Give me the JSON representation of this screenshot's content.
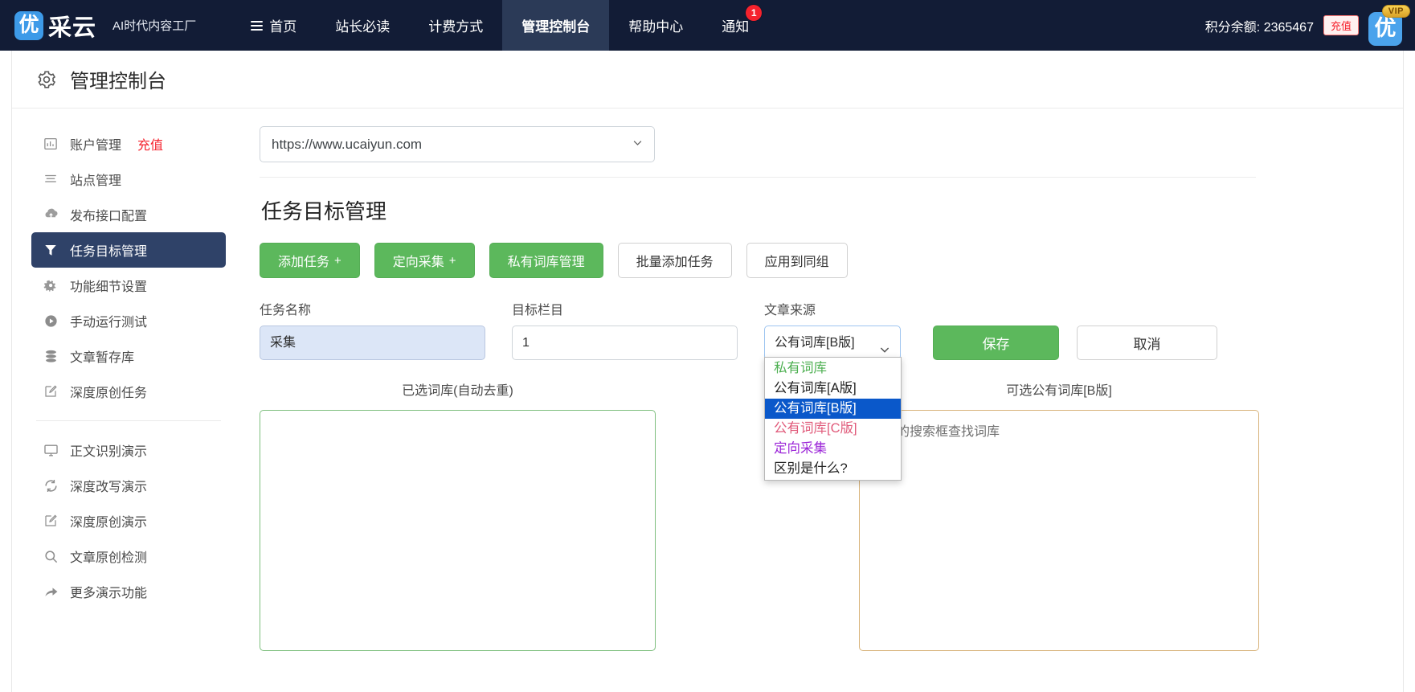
{
  "topnav": {
    "logo_badge": "优",
    "logo_text": "采云",
    "slogan": "AI时代内容工厂",
    "items": [
      {
        "label": "首页",
        "icon": "hamburger-icon",
        "active": false,
        "badge": ""
      },
      {
        "label": "站长必读",
        "icon": "",
        "active": false,
        "badge": ""
      },
      {
        "label": "计费方式",
        "icon": "",
        "active": false,
        "badge": ""
      },
      {
        "label": "管理控制台",
        "icon": "",
        "active": true,
        "badge": ""
      },
      {
        "label": "帮助中心",
        "icon": "",
        "active": false,
        "badge": ""
      },
      {
        "label": "通知",
        "icon": "",
        "active": false,
        "badge": "1"
      }
    ],
    "points_label": "积分余额: 2365467",
    "recharge_label": "充值",
    "avatar_letter": "优",
    "vip_label": "VIP",
    "colors": {
      "bar_bg": "#121c36",
      "active_bg": "#2b3a57",
      "badge_red": "#f5222d",
      "logo_blue": "#3d9ae8"
    }
  },
  "page": {
    "title": "管理控制台",
    "title_icon": "gear-icon"
  },
  "sidebar": {
    "items": [
      {
        "label": "账户管理",
        "sub": "充值",
        "icon": "chart-bar-icon",
        "active": false
      },
      {
        "label": "站点管理",
        "sub": "",
        "icon": "list-lines-icon",
        "active": false
      },
      {
        "label": "发布接口配置",
        "sub": "",
        "icon": "cloud-upload-icon",
        "active": false
      },
      {
        "label": "任务目标管理",
        "sub": "",
        "icon": "filter-icon",
        "active": true
      },
      {
        "label": "功能细节设置",
        "sub": "",
        "icon": "gears-icon",
        "active": false
      },
      {
        "label": "手动运行测试",
        "sub": "",
        "icon": "play-circle-icon",
        "active": false
      },
      {
        "label": "文章暂存库",
        "sub": "",
        "icon": "database-icon",
        "active": false
      },
      {
        "label": "深度原创任务",
        "sub": "",
        "icon": "edit-square-icon",
        "active": false
      }
    ],
    "items2": [
      {
        "label": "正文识别演示",
        "icon": "monitor-icon"
      },
      {
        "label": "深度改写演示",
        "icon": "refresh-icon"
      },
      {
        "label": "深度原创演示",
        "icon": "edit-square-icon"
      },
      {
        "label": "文章原创检测",
        "icon": "search-icon"
      },
      {
        "label": "更多演示功能",
        "icon": "arrow-right-curve-icon"
      }
    ]
  },
  "main": {
    "site_select": {
      "value": "https://www.ucaiyun.com",
      "icon": "chevron-down-icon"
    },
    "section_title": "任务目标管理",
    "buttons": [
      {
        "label": "添加任务",
        "plus": "+",
        "style": "green"
      },
      {
        "label": "定向采集",
        "plus": "+",
        "style": "green"
      },
      {
        "label": "私有词库管理",
        "plus": "",
        "style": "green"
      },
      {
        "label": "批量添加任务",
        "plus": "",
        "style": "white"
      },
      {
        "label": "应用到同组",
        "plus": "",
        "style": "white"
      }
    ],
    "form": {
      "task_name": {
        "label": "任务名称",
        "value": "采集",
        "placeholder": ""
      },
      "target_column": {
        "label": "目标栏目",
        "value": "1",
        "placeholder": ""
      },
      "article_source": {
        "label": "文章来源",
        "value": "公有词库[B版]",
        "options": [
          {
            "label": "私有词库",
            "color": "#4caf50",
            "selected": false
          },
          {
            "label": "公有词库[A版]",
            "color": "#222222",
            "selected": false
          },
          {
            "label": "公有词库[B版]",
            "color": "#222222",
            "selected": true
          },
          {
            "label": "公有词库[C版]",
            "color": "#e05a7a",
            "selected": false
          },
          {
            "label": "定向采集",
            "color": "#9c27d8",
            "selected": false
          },
          {
            "label": "区别是什么?",
            "color": "#222222",
            "selected": false
          }
        ]
      },
      "save_label": "保存",
      "cancel_label": "取消"
    },
    "panel_left": {
      "title": "已选词库(自动去重)",
      "body": ""
    },
    "panel_right": {
      "title": "可选公有词库[B版]",
      "body": "下面的搜索框查找词库"
    }
  }
}
